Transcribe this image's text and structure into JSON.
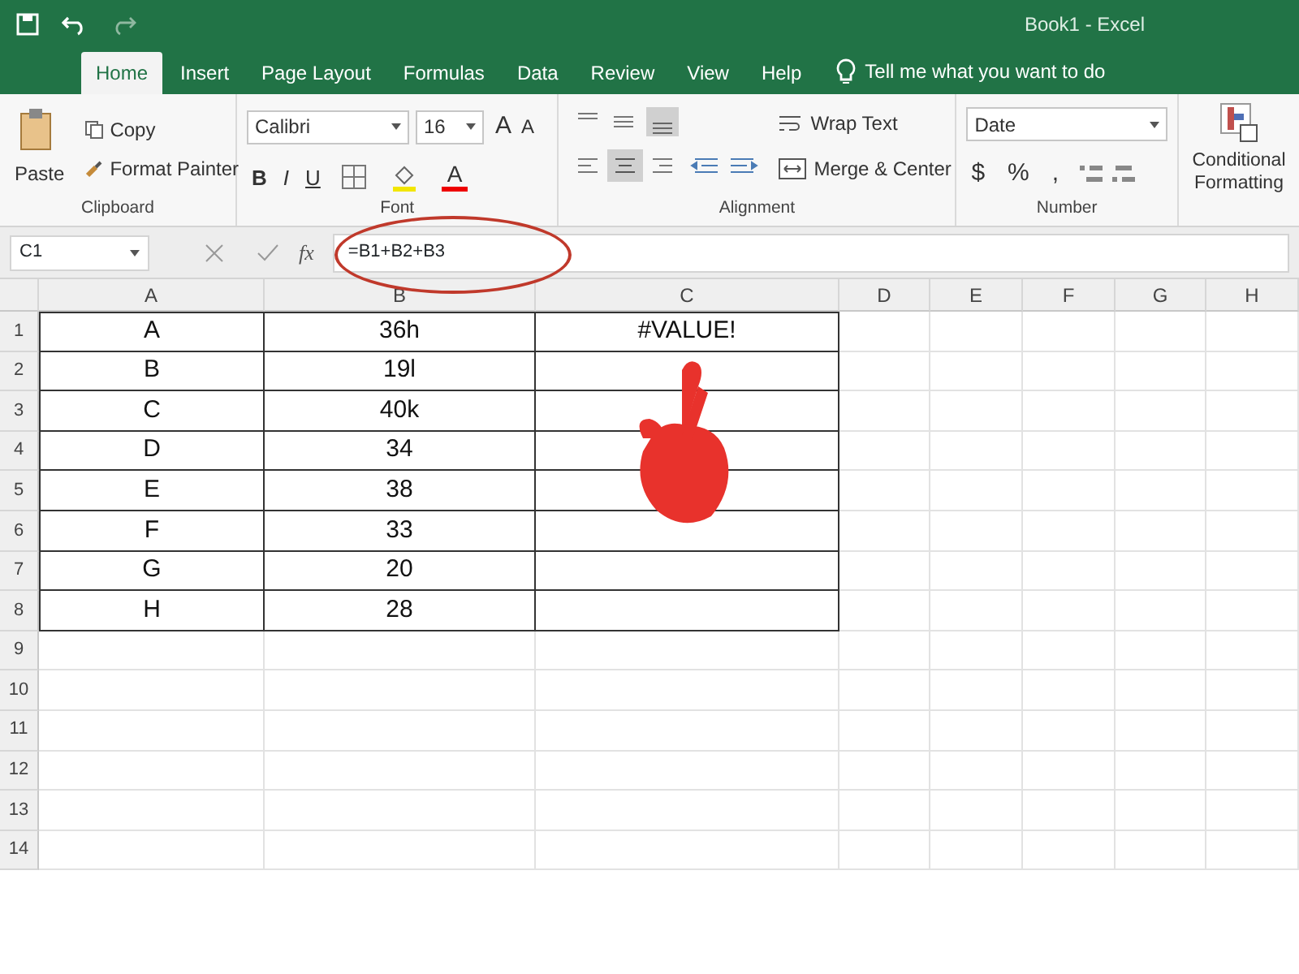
{
  "title_bar": {
    "title": "Book1  -  Excel"
  },
  "tabs": [
    {
      "label": "Home",
      "selected": true
    },
    {
      "label": "Insert",
      "selected": false
    },
    {
      "label": "Page Layout",
      "selected": false
    },
    {
      "label": "Formulas",
      "selected": false
    },
    {
      "label": "Data",
      "selected": false
    },
    {
      "label": "Review",
      "selected": false
    },
    {
      "label": "View",
      "selected": false
    },
    {
      "label": "Help",
      "selected": false
    }
  ],
  "tell_me": {
    "placeholder": "Tell me what you want to do"
  },
  "ribbon": {
    "clipboard": {
      "paste": "Paste",
      "copy": "Copy",
      "format_painter": "Format Painter",
      "label": "Clipboard"
    },
    "font": {
      "name": "Calibri",
      "size": "16",
      "size_buttons": [
        "A",
        "A"
      ],
      "style_buttons": [
        "B",
        "I",
        "U"
      ],
      "font_color": "A",
      "label": "Font"
    },
    "alignment": {
      "wrap_text": "Wrap Text",
      "merge_center": "Merge & Center",
      "label": "Alignment"
    },
    "number": {
      "format": "Date",
      "buttons": [
        "$",
        "%",
        ","
      ],
      "label": "Number"
    },
    "styles": {
      "conditional_formatting": "Conditional Formatting"
    }
  },
  "formula_bar": {
    "name_box": "C1",
    "function_label": "fx",
    "formula": "=B1+B2+B3"
  },
  "sheet": {
    "columns": [
      "A",
      "B",
      "C",
      "D",
      "E",
      "F",
      "G",
      "H"
    ],
    "rows": [
      {
        "number": "1",
        "cells": [
          "A",
          "36h",
          "#VALUE!"
        ]
      },
      {
        "number": "2",
        "cells": [
          "B",
          "19l"
        ]
      },
      {
        "number": "3",
        "cells": [
          "C",
          "40k"
        ]
      },
      {
        "number": "4",
        "cells": [
          "D",
          "34"
        ]
      },
      {
        "number": "5",
        "cells": [
          "E",
          "38"
        ]
      },
      {
        "number": "6",
        "cells": [
          "F",
          "33"
        ]
      },
      {
        "number": "7",
        "cells": [
          "G",
          "20"
        ]
      },
      {
        "number": "8",
        "cells": [
          "H",
          "28"
        ]
      },
      {
        "number": "9",
        "cells": []
      },
      {
        "number": "10",
        "cells": []
      },
      {
        "number": "11",
        "cells": []
      },
      {
        "number": "12",
        "cells": []
      },
      {
        "number": "13",
        "cells": []
      },
      {
        "number": "14",
        "cells": []
      }
    ]
  }
}
